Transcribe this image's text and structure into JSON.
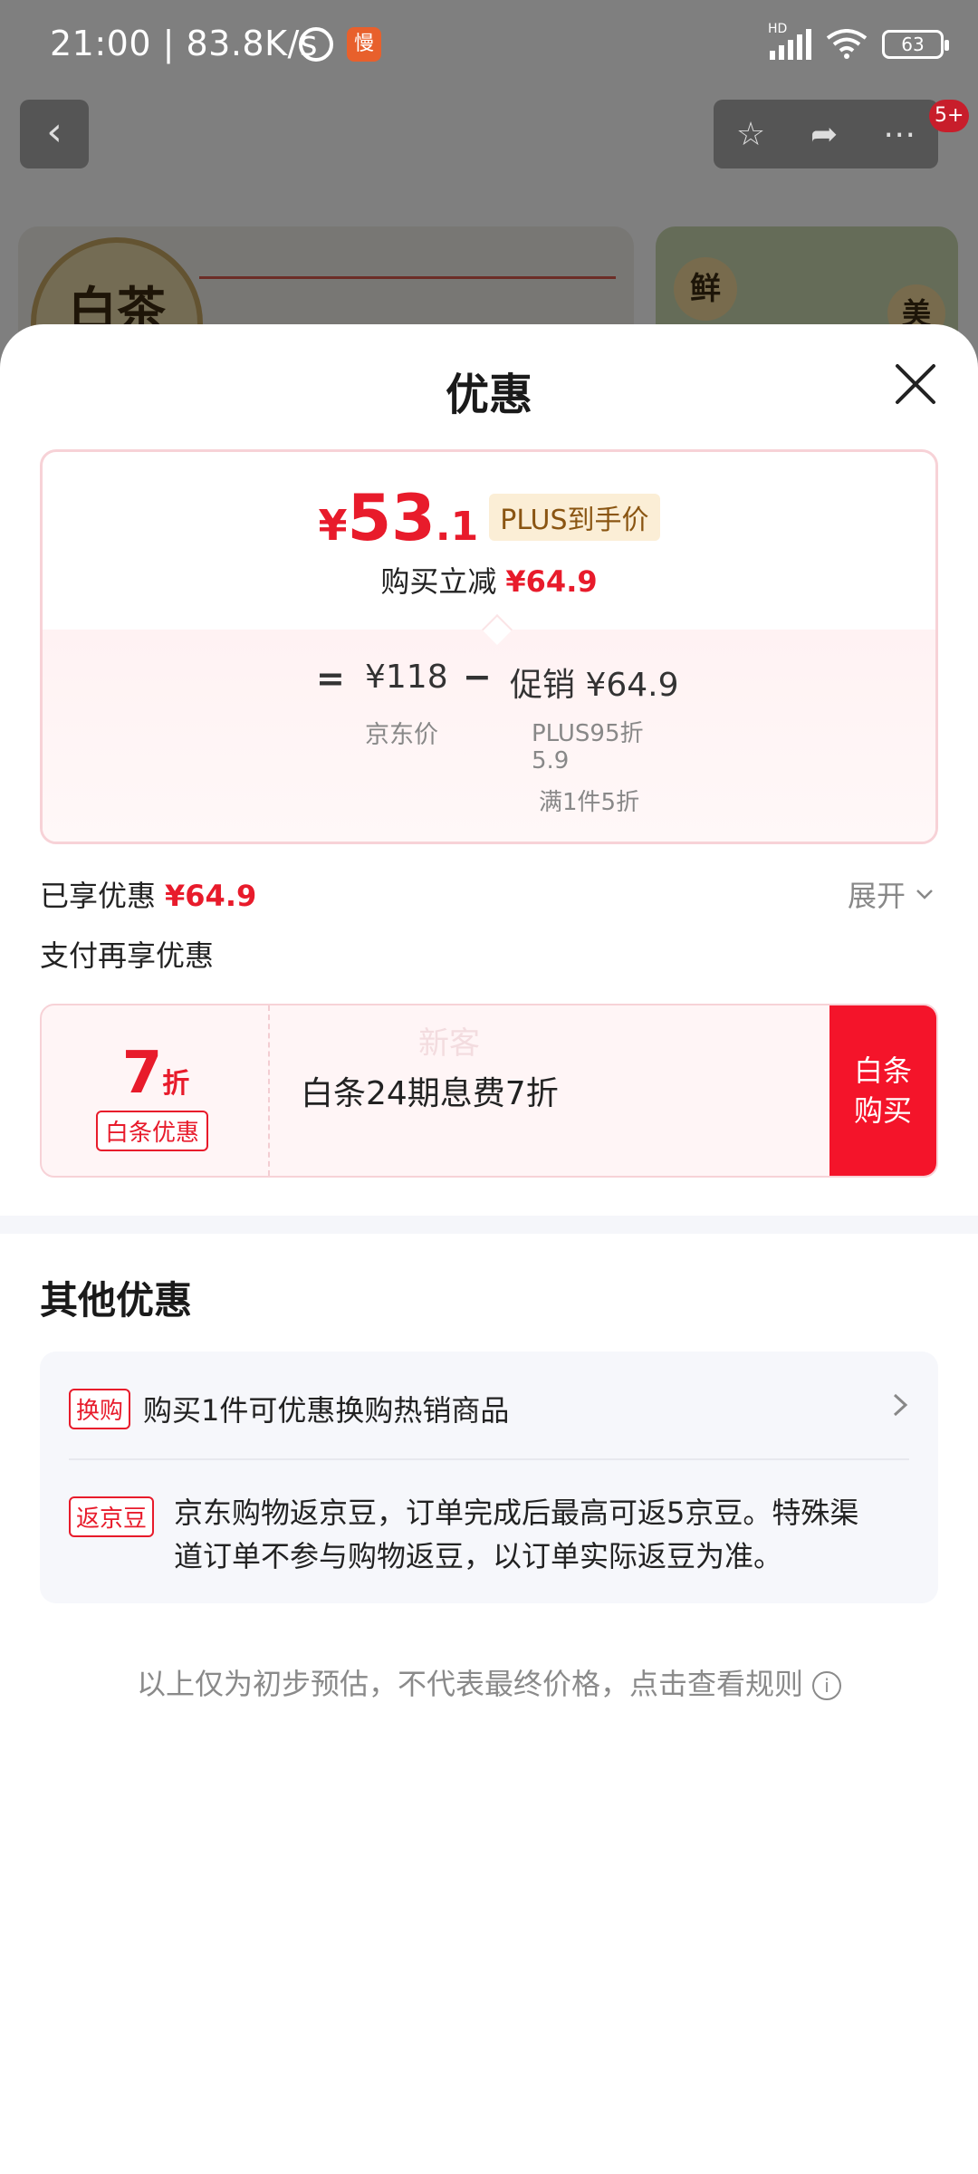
{
  "status_bar": {
    "time_speed": "21:00 | 83.8K/s",
    "app_badge": "慢",
    "network": "HD",
    "battery": "63"
  },
  "nav": {
    "badge": "5+"
  },
  "background": {
    "product_badge_text": "白茶",
    "tag_fresh": "鲜",
    "tag_beauty": "美"
  },
  "sheet": {
    "title": "优惠",
    "price_card": {
      "currency": "¥",
      "price_int": "53",
      "price_dec": ".1",
      "plus_label": "PLUS到手价",
      "reduce_label": "购买立减",
      "reduce_value": "¥64.9",
      "eq": "=",
      "jd_price": "¥118",
      "minus": "−",
      "promo": "促销 ¥64.9",
      "jd_price_label": "京东价",
      "promo_sub1": "PLUS95折",
      "promo_sub2": "5.9",
      "promo_sub3": "满1件5折"
    },
    "enjoyed_label": "已享优惠",
    "enjoyed_value": "¥64.9",
    "expand_label": "展开",
    "pay_again": "支付再享优惠",
    "baitiao": {
      "discount_num": "7",
      "discount_unit": "折",
      "tag": "白条优惠",
      "watermark": "新客",
      "text": "白条24期息费7折",
      "buy_line1": "白条",
      "buy_line2": "购买"
    },
    "other_title": "其他优惠",
    "other": [
      {
        "tag": "换购",
        "text": "购买1件可优惠换购热销商品"
      },
      {
        "tag": "返京豆",
        "text": "京东购物返京豆，订单完成后最高可返5京豆。特殊渠道订单不参与购物返豆，以订单实际返豆为准。"
      }
    ],
    "footnote": "以上仅为初步预估，不代表最终价格，点击查看规则"
  },
  "colors": {
    "accent_red": "#e81b2b",
    "buy_red": "#f4142a"
  }
}
